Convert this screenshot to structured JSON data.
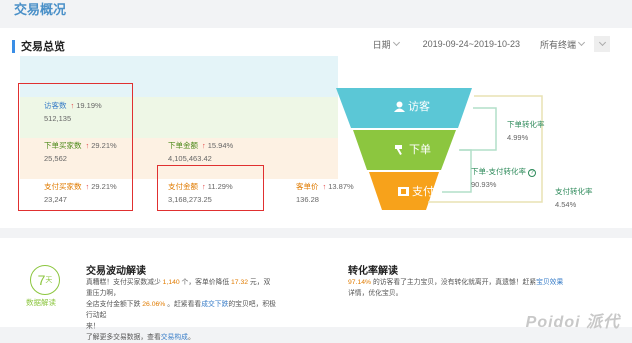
{
  "page": {
    "title": "交易概况"
  },
  "overview": {
    "title": "交易总览",
    "date_label": "日期",
    "date_range": "2019-09-24~2019-10-23",
    "terminal_label": "所有终端"
  },
  "metrics": {
    "visitors": {
      "label": "访客数",
      "change": "19.19%",
      "value": "512,135"
    },
    "order_buyers": {
      "label": "下单买家数",
      "change": "29.21%",
      "value": "25,562"
    },
    "order_amount": {
      "label": "下单金额",
      "change": "15.94%",
      "value": "4,105,463.42"
    },
    "pay_buyers": {
      "label": "支付买家数",
      "change": "29.21%",
      "value": "23,247"
    },
    "pay_amount": {
      "label": "支付金额",
      "change": "11.29%",
      "value": "3,168,273.25"
    },
    "avg_price": {
      "label": "客单价",
      "change": "13.87%",
      "value": "136.28"
    },
    "up_arrow": "↑"
  },
  "funnel": {
    "visit": "访客",
    "order": "下单",
    "pay": "支付",
    "colors": {
      "visit": "#5bc7d6",
      "order": "#8cc63f",
      "pay": "#f7a21b"
    }
  },
  "rates": {
    "order_rate": {
      "label": "下单转化率",
      "value": "4.99%"
    },
    "order_pay_rate": {
      "label": "下单-支付转化率",
      "value": "90.93%",
      "icon": "?"
    },
    "pay_rate": {
      "label": "支付转化率",
      "value": "4.54%"
    }
  },
  "bottom": {
    "badge_num": "7",
    "badge_unit": "天",
    "badge_caption": "数据解读",
    "trend": {
      "title": "交易波动解读",
      "line1_a": "真糟糕！支付买家数减少 ",
      "line1_n1": "1,140",
      "line1_b": " 个，客单价降低 ",
      "line1_n2": "17.32",
      "line1_c": " 元，双重压力啊，",
      "line2_a": "全店支付金额下跌 ",
      "line2_n": "26.06%",
      "line2_b": " 。赶紧看看",
      "line2_link": "成交下跌",
      "line2_c": "的宝贝吧，积极行动起",
      "line3": "来！",
      "line4_a": "了解更多交易数据，查看",
      "line4_link": "交易构成",
      "line4_b": "。"
    },
    "conversion": {
      "title": "转化率解读",
      "line1_n": "97.14%",
      "line1_a": " 的访客看了主力宝贝，没有转化就离开，真遗憾！赶紧",
      "line1_link": "宝贝效果",
      "line2": "详情，优化宝贝。"
    },
    "watermark": "Poidoi 派代"
  }
}
